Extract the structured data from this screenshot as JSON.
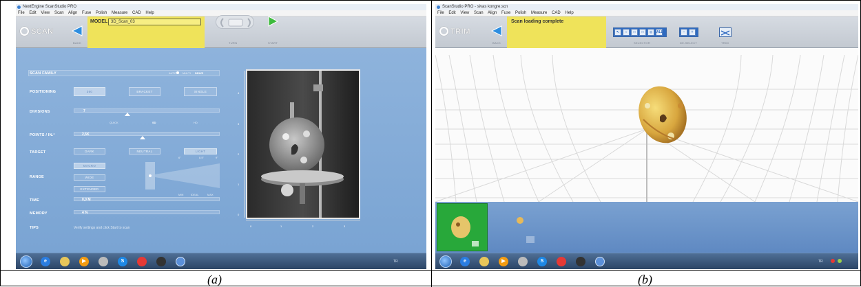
{
  "captions": {
    "a": "(a)",
    "b": "(b)"
  },
  "colors": {
    "toolbar_highlight": "#efe35a",
    "panel_blue": "#7aa4d3",
    "thumb_active": "#28a83a"
  },
  "left": {
    "window_title": "NextEngine ScanStudio PRO",
    "menu": [
      "File",
      "Edit",
      "View",
      "Scan",
      "Align",
      "Fuse",
      "Polish",
      "Measure",
      "CAD",
      "Help"
    ],
    "mode": "SCAN",
    "back_label": "BACK",
    "model_label": "MODEL",
    "model_value": "3D_Scan_03",
    "turn_label": "TURN",
    "start_label": "START",
    "scan_family": "SCAN FAMILY",
    "auto": "AUTO",
    "multi": "MULTI",
    "drive": "DRIVE",
    "positioning": {
      "label": "POSITIONING",
      "options": [
        "360",
        "BRACKET",
        "SINGLE"
      ]
    },
    "divisions": {
      "label": "DIVISIONS",
      "value": "7"
    },
    "quality": [
      "QUICK",
      "SD",
      "HD"
    ],
    "points": {
      "label": "POINTS / IN.²",
      "value": "2,5K"
    },
    "target": {
      "label": "TARGET",
      "options": [
        "DARK",
        "NEUTRAL",
        "LIGHT"
      ]
    },
    "range": {
      "label": "RANGE",
      "options": [
        "MACRO",
        "WIDE",
        "EXTENDED"
      ],
      "dims": [
        "6\"",
        "8.5\"",
        "9\""
      ],
      "scale": [
        "MIN",
        "IDEAL",
        "MAX"
      ]
    },
    "time": {
      "label": "TIME",
      "value": "0,0 M"
    },
    "memory": {
      "label": "MEMORY",
      "value": "4 %"
    },
    "tips": {
      "label": "TIPS",
      "text": "Verify settings and click Start to scan"
    },
    "ruler_v": [
      "4",
      "3",
      "2",
      "1",
      "0"
    ],
    "ruler_h": [
      "0",
      "1",
      "2",
      "3"
    ]
  },
  "right": {
    "window_title": "ScanStudio PRO - sivas kongre.scn",
    "menu": [
      "File",
      "Edit",
      "View",
      "Scan",
      "Align",
      "Fuse",
      "Polish",
      "Measure",
      "CAD",
      "Help"
    ],
    "mode": "TRIM",
    "back_label": "BACK",
    "status": "Scan loading complete",
    "selector_label": "SELECTOR",
    "deselect_label": "DE-SELECT",
    "trim_label": "TRIM",
    "selector_tools": [
      "↖",
      "○",
      "□",
      "□",
      "◇",
      "ALL"
    ],
    "deselect_tools": [
      "−",
      "+"
    ]
  },
  "taskbar_tray": {
    "left": "TR",
    "right": "TR"
  }
}
